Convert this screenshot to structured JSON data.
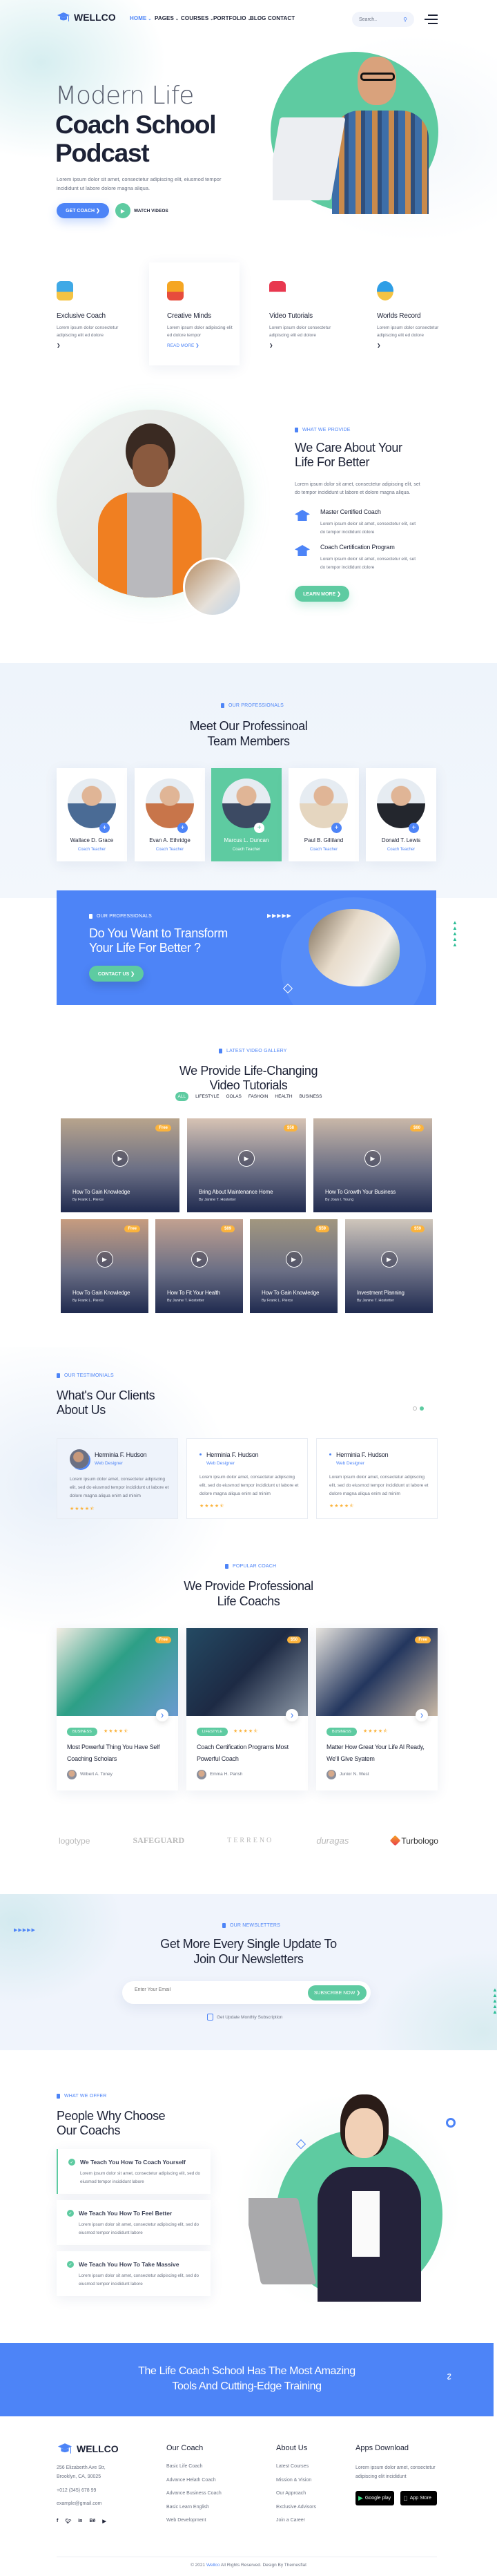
{
  "colors": {
    "primary": "#4d84f7",
    "accent": "#5ecba1",
    "dark": "#1d2236",
    "text": "#6c7383",
    "star": "#fbb33c"
  },
  "brand": {
    "name": "WELLCO",
    "logo_icon": "graduation-cap-icon"
  },
  "nav": {
    "items": [
      {
        "label": "HOME",
        "dropdown": true,
        "active": true
      },
      {
        "label": "PAGES",
        "dropdown": true
      },
      {
        "label": "COURSES",
        "dropdown": true
      },
      {
        "label": "PORTFOLIO",
        "dropdown": true
      },
      {
        "label": "BLOG",
        "dropdown": false
      },
      {
        "label": "CONTACT",
        "dropdown": false
      }
    ],
    "search_placeholder": "Search..",
    "search_icon": "search-icon",
    "menu_icon": "hamburger-menu-icon"
  },
  "hero": {
    "title_light": "Modern Life",
    "title_line2": "Coach School",
    "title_line3": "Podcast",
    "text": "Lorem ipsum dolor sit amet, consectetur adipiscing elit,  eiusmod tempor incididunt ut labore dolore magna aliqua.",
    "primary_button": "GET COACH ❯",
    "secondary_button": "WATCH VIDEOS"
  },
  "services": [
    {
      "icon": "backpack-icon",
      "title": "Exclusive Coach",
      "text": "Lorem ipsum dolor consectetur adipiscing elit ed dolore",
      "link": "❯"
    },
    {
      "icon": "lightbulb-icon",
      "title": "Creative Minds",
      "text": "Lorem ipsum dolor adipiscing elit ed dolore tempor",
      "link": "READ MORE ❯"
    },
    {
      "icon": "video-play-icon",
      "title": "Video Tutorials",
      "text": "Lorem ipsum dolor consectetur adipiscing elit ed dolore",
      "link": "❯"
    },
    {
      "icon": "globe-icon",
      "title": "Worlds Record",
      "text": "Lorem ipsum dolor consectetur adipiscing elit ed dolore",
      "link": "❯"
    }
  ],
  "about": {
    "tag": "WHAT WE PROVIDE",
    "title": "We Care About Your Life For Better",
    "text": "Lorem ipsum dolor sit amet, consectetur adipiscing elit,  set do tempor incididunt ut labore et dolore magna aliqua.",
    "features": [
      {
        "icon": "graduation-cap-icon",
        "title": "Master Certified Coach",
        "text": "Lorem ipsum dolor sit amet, consectetur elit, set do tempor incididunt dolore"
      },
      {
        "icon": "graduation-cap-icon",
        "title": "Coach Certification Program",
        "text": "Lorem ipsum dolor sit amet, consectetur elit, set do tempor incididunt dolore"
      }
    ],
    "button": "LEARN MORE ❯"
  },
  "team": {
    "tag": "OUR PROFESSIONALS",
    "title": "Meet Our Professinoal Team Members",
    "members": [
      {
        "name": "Wallace D. Grace",
        "role": "Coach Teacher"
      },
      {
        "name": "Evan A. Ethridge",
        "role": "Coach Teacher"
      },
      {
        "name": "Marcus L. Duncan",
        "role": "Coach Teacher",
        "highlighted": true
      },
      {
        "name": "Paul B. Gilliland",
        "role": "Coach Teacher"
      },
      {
        "name": "Donald T. Lewis",
        "role": "Coach Teacher"
      }
    ]
  },
  "cta": {
    "tag": "OUR PROFESSIONALS",
    "title": "Do You Want to Transform Your Life For Better ?",
    "button": "CONTACT US ❯"
  },
  "videos": {
    "tag": "LATEST VIDEO GALLERY",
    "title_line1": "We Provide Life-Changing",
    "title_line2": "Video Tutorials",
    "filters": [
      {
        "label": "ALL",
        "active": true
      },
      {
        "label": "LIFESTYLE"
      },
      {
        "label": "GOLAS"
      },
      {
        "label": "FASHOIN"
      },
      {
        "label": "HEALTH"
      },
      {
        "label": "BUSINESS"
      }
    ],
    "items": [
      {
        "title": "How To Gain Knowledge",
        "author": "By Frank L. Pierce",
        "price": "Free"
      },
      {
        "title": "Bring About Maintenance Home",
        "author": "By Janine T. Hostetter",
        "price": "$58"
      },
      {
        "title": "How To Growth Your Business",
        "author": "By Joan I. Young",
        "price": "$60"
      },
      {
        "title": "How To Gain Knowledge",
        "author": "By Frank L. Pierce",
        "price": "Free"
      },
      {
        "title": "How To Fit Your Health",
        "author": "By Janine T. Hostetter",
        "price": "$89"
      },
      {
        "title": "How To Gain Knowledge",
        "author": "By Frank L. Pierce",
        "price": "$59"
      },
      {
        "title": "Investment Planning",
        "author": "By Janine T. Hostetter",
        "price": "$59"
      }
    ]
  },
  "testimonials": {
    "tag": "OUR TESTIMONIALS",
    "title_line1": "What's Our Clients",
    "title_line2": "About Us",
    "active_slide": 2,
    "slide_count": 2,
    "items": [
      {
        "name": "Herminia F. Hudson",
        "role": "Web Designer",
        "text": "Lorem ipsum dolor amet, consectetur adipiscing elit, sed do eiusmod tempor incididunt ut labore et dolore magna aliqua enim ad minim",
        "rating": 4.5
      },
      {
        "name": "Herminia F. Hudson",
        "role": "Web Designer",
        "text": "Lorem ipsum dolor amet, consectetur adipiscing elit, sed do eiusmod tempor incididunt ut labore et dolore magna aliqua enim ad minim",
        "rating": 4.5
      },
      {
        "name": "Herminia F. Hudson",
        "role": "Web Designer",
        "text": "Lorem ipsum dolor amet, consectetur adipiscing elit, sed do eiusmod tempor incididunt ut labore et dolore magna aliqua enim ad minim",
        "rating": 4.5
      }
    ]
  },
  "coaches": {
    "tag": "POPULAR COACH",
    "title_line1": "We Provide Professional",
    "title_line2": "Life Coachs",
    "items": [
      {
        "category": "BUSINESS",
        "price": "Free",
        "rating": 4.5,
        "title": "Most Powerful Thing You Have Self Coaching Scholars",
        "author": "Wilbert A. Toney"
      },
      {
        "category": "LIFESTYLE",
        "price": "$50",
        "rating": 4.5,
        "title": "Coach Certification Programs Most Powerful Coach",
        "author": "Emma H. Parish"
      },
      {
        "category": "BUSINESS",
        "price": "Free",
        "rating": 4.5,
        "title": "Matter How Great Your Life Al Ready, We'll Give Syatem",
        "author": "Junior N. West"
      }
    ]
  },
  "partners": [
    "logotype",
    "SAFEGUARD",
    "TERRENO",
    "duragas",
    "Turbologo"
  ],
  "newsletter": {
    "tag": "OUR NEWSLETTERS",
    "title_line1": "Get More Every Single Update To",
    "title_line2": "Join Our Newsletters",
    "placeholder": "Enter Your Email",
    "button": "SUBSCRIBE NOW ❯",
    "checkbox_label": "Get Update Monthly Subscription",
    "checkbox_checked": false
  },
  "why": {
    "tag": "WHAT WE OFFER",
    "title_line1": "People Why Choose",
    "title_line2": "Our Coachs",
    "items": [
      {
        "title": "We Teach You How To Coach Yourself",
        "text": "Lorem ipsum dolor sit amet, consectetur adipiscing elit, sed do eiusmod tempor incididunt labore",
        "active": true
      },
      {
        "title": "We Teach You How To Feel Better",
        "text": "Lorem ipsum dolor sit amet, consectetur adipiscing elit, sed do eiusmod tempor incididunt labore"
      },
      {
        "title": "We Teach You How To Take Massive",
        "text": "Lorem ipsum dolor sit amet, consectetur adipiscing elit, sed do eiusmod tempor incididunt labore"
      }
    ]
  },
  "banner": {
    "line1": "The Life Coach School Has The Most Amazing",
    "line2": "Tools And Cutting-Edge Training"
  },
  "footer": {
    "brand": "WELLCO",
    "address": "256 Elizaberth Ave Str, Brooklyn, CA, 90025",
    "phone": "+012 (345) 678 99",
    "email": "example@gmail.com",
    "socials": [
      "facebook-icon",
      "twitter-icon",
      "linkedin-icon",
      "behance-icon",
      "youtube-icon"
    ],
    "columns": [
      {
        "title": "Our Coach",
        "links": [
          "Basic Life Coach",
          "Advance Helath Coach",
          "Advance Business Coach",
          "Basic Learn English",
          "Web Development"
        ]
      },
      {
        "title": "About Us",
        "links": [
          "Latest Courses",
          "Mission & Vision",
          "Our Approach",
          "Exclusive Advisors",
          "Join a Career"
        ]
      }
    ],
    "apps": {
      "title": "Apps Download",
      "text": "Lorem ipsum dolor amet, consectetur adipiscing elit incididunt",
      "google": "Google play",
      "apple": "App Store"
    },
    "copyright_prefix": "© 2021",
    "copyright_brand": "Wellco",
    "copyright_suffix": "All Rights Reserved. Design By Themesflat"
  }
}
